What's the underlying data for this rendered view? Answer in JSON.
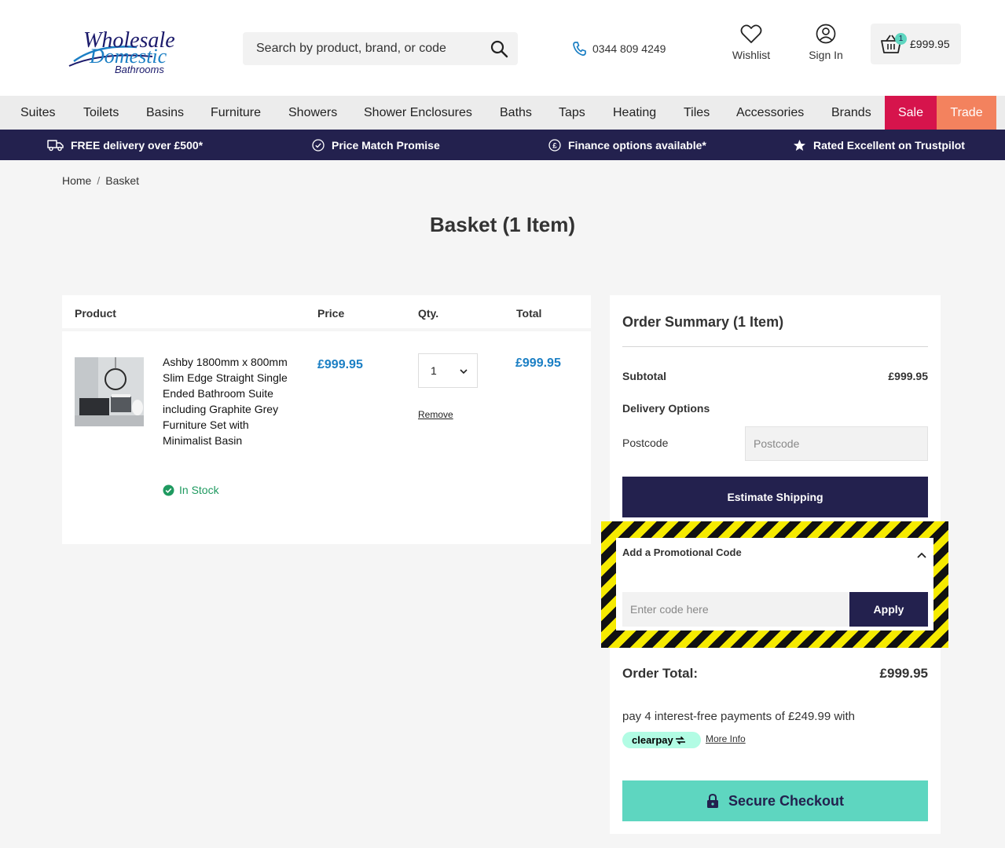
{
  "header": {
    "logo": {
      "line1": "Wholesale",
      "line2": "Domestic",
      "line3": "Bathrooms"
    },
    "search": {
      "placeholder": "Search by product, brand, or code",
      "icon": "search-icon"
    },
    "phone": {
      "number": "0344 809 4249",
      "icon": "phone-icon"
    },
    "wishlist": {
      "label": "Wishlist",
      "icon": "heart-icon"
    },
    "signin": {
      "label": "Sign In",
      "icon": "user-icon"
    },
    "basket": {
      "count": "1",
      "total": "£999.95",
      "icon": "basket-icon"
    }
  },
  "nav": {
    "items": [
      "Suites",
      "Toilets",
      "Basins",
      "Furniture",
      "Showers",
      "Shower Enclosures",
      "Baths",
      "Taps",
      "Heating",
      "Tiles",
      "Accessories",
      "Brands"
    ],
    "sale": "Sale",
    "trade": "Trade"
  },
  "usp": [
    {
      "text": "FREE delivery over £500*",
      "icon": "truck-icon"
    },
    {
      "text": "Price Match Promise",
      "icon": "check-circle-icon"
    },
    {
      "text": "Finance options available*",
      "icon": "pound-circle-icon"
    },
    {
      "text": "Rated Excellent on Trustpilot",
      "icon": "star-icon"
    }
  ],
  "breadcrumb": {
    "home": "Home",
    "separator": "/",
    "current": "Basket"
  },
  "page_title": "Basket (1 Item)",
  "table": {
    "headers": {
      "product": "Product",
      "price": "Price",
      "qty": "Qty.",
      "total": "Total"
    },
    "rows": [
      {
        "name": "Ashby 1800mm x 800mm Slim Edge Straight Single Ended Bathroom Suite including Graphite Grey Furniture Set with Minimalist Basin",
        "stock": "In Stock",
        "price": "£999.95",
        "qty": "1",
        "total": "£999.95",
        "remove": "Remove"
      }
    ]
  },
  "summary": {
    "title": "Order Summary (1 Item)",
    "subtotal_label": "Subtotal",
    "subtotal_value": "£999.95",
    "delivery_label": "Delivery Options",
    "postcode_label": "Postcode",
    "postcode_placeholder": "Postcode",
    "estimate_button": "Estimate Shipping",
    "promo_title": "Add a Promotional Code",
    "promo_placeholder": "Enter code here",
    "apply_button": "Apply",
    "total_label": "Order Total:",
    "total_value": "£999.95",
    "clearpay_text": "pay 4 interest-free payments of £249.99 with",
    "clearpay_logo": "clearpay",
    "clearpay_more": "More Info",
    "checkout_button": "Secure Checkout"
  },
  "colors": {
    "navy": "#23214e",
    "sale": "#d6144c",
    "trade": "#f3825e",
    "teal": "#5ed6c0",
    "price_blue": "#1b7fc4",
    "stock_green": "#1f9a60",
    "highlight_yellow": "#f5ea00"
  }
}
